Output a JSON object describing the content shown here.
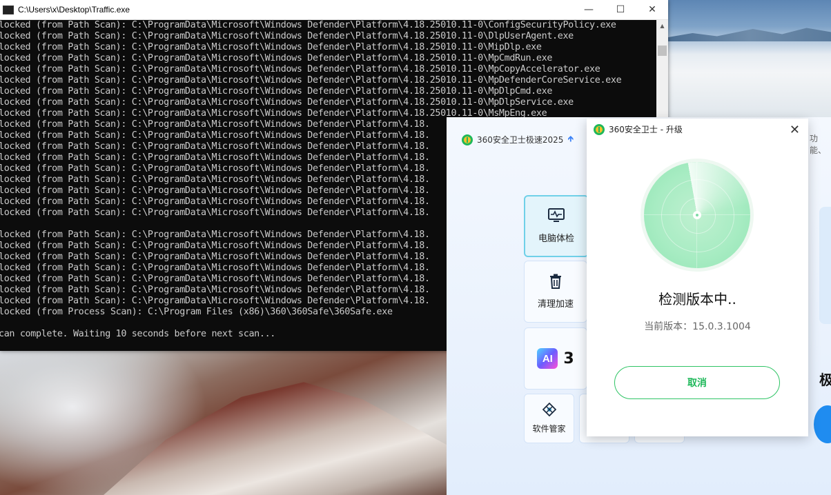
{
  "console": {
    "title": "C:\\Users\\x\\Desktop\\Traffic.exe",
    "lines": [
      "locked (from Path Scan): C:\\ProgramData\\Microsoft\\Windows Defender\\Platform\\4.18.25010.11-0\\ConfigSecurityPolicy.exe",
      "locked (from Path Scan): C:\\ProgramData\\Microsoft\\Windows Defender\\Platform\\4.18.25010.11-0\\DlpUserAgent.exe",
      "locked (from Path Scan): C:\\ProgramData\\Microsoft\\Windows Defender\\Platform\\4.18.25010.11-0\\MipDlp.exe",
      "locked (from Path Scan): C:\\ProgramData\\Microsoft\\Windows Defender\\Platform\\4.18.25010.11-0\\MpCmdRun.exe",
      "locked (from Path Scan): C:\\ProgramData\\Microsoft\\Windows Defender\\Platform\\4.18.25010.11-0\\MpCopyAccelerator.exe",
      "locked (from Path Scan): C:\\ProgramData\\Microsoft\\Windows Defender\\Platform\\4.18.25010.11-0\\MpDefenderCoreService.exe",
      "locked (from Path Scan): C:\\ProgramData\\Microsoft\\Windows Defender\\Platform\\4.18.25010.11-0\\MpDlpCmd.exe",
      "locked (from Path Scan): C:\\ProgramData\\Microsoft\\Windows Defender\\Platform\\4.18.25010.11-0\\MpDlpService.exe",
      "locked (from Path Scan): C:\\ProgramData\\Microsoft\\Windows Defender\\Platform\\4.18.25010.11-0\\MsMpEng.exe",
      "locked (from Path Scan): C:\\ProgramData\\Microsoft\\Windows Defender\\Platform\\4.18.",
      "locked (from Path Scan): C:\\ProgramData\\Microsoft\\Windows Defender\\Platform\\4.18.",
      "locked (from Path Scan): C:\\ProgramData\\Microsoft\\Windows Defender\\Platform\\4.18.",
      "locked (from Path Scan): C:\\ProgramData\\Microsoft\\Windows Defender\\Platform\\4.18.",
      "locked (from Path Scan): C:\\ProgramData\\Microsoft\\Windows Defender\\Platform\\4.18.",
      "locked (from Path Scan): C:\\ProgramData\\Microsoft\\Windows Defender\\Platform\\4.18.",
      "locked (from Path Scan): C:\\ProgramData\\Microsoft\\Windows Defender\\Platform\\4.18.",
      "locked (from Path Scan): C:\\ProgramData\\Microsoft\\Windows Defender\\Platform\\4.18.",
      "locked (from Path Scan): C:\\ProgramData\\Microsoft\\Windows Defender\\Platform\\4.18.",
      "",
      "locked (from Path Scan): C:\\ProgramData\\Microsoft\\Windows Defender\\Platform\\4.18.",
      "locked (from Path Scan): C:\\ProgramData\\Microsoft\\Windows Defender\\Platform\\4.18.",
      "locked (from Path Scan): C:\\ProgramData\\Microsoft\\Windows Defender\\Platform\\4.18.",
      "locked (from Path Scan): C:\\ProgramData\\Microsoft\\Windows Defender\\Platform\\4.18.",
      "locked (from Path Scan): C:\\ProgramData\\Microsoft\\Windows Defender\\Platform\\4.18.",
      "locked (from Path Scan): C:\\ProgramData\\Microsoft\\Windows Defender\\Platform\\4.18.",
      "locked (from Path Scan): C:\\ProgramData\\Microsoft\\Windows Defender\\Platform\\4.18.",
      "locked (from Process Scan): C:\\Program Files (x86)\\360\\360Safe\\360Safe.exe",
      "",
      "can complete. Waiting 10 seconds before next scan..."
    ]
  },
  "main360": {
    "title": "360安全卫士极速2025",
    "right_cut_text": "功能、",
    "cards": {
      "pc_checkup": "电脑体检",
      "clean_speedup": "清理加速",
      "ai_badge": "AI",
      "ai_partial": "3",
      "software_manager": "软件管家"
    },
    "speed_partial": "极"
  },
  "dialog": {
    "title": "360安全卫士 - 升级",
    "status": "检测版本中..",
    "version": "当前版本：15.0.3.1004",
    "cancel": "取消"
  },
  "colors": {
    "accent_green": "#1fb85a",
    "console_bg": "#0c0c0c",
    "console_text": "#cccccc"
  }
}
